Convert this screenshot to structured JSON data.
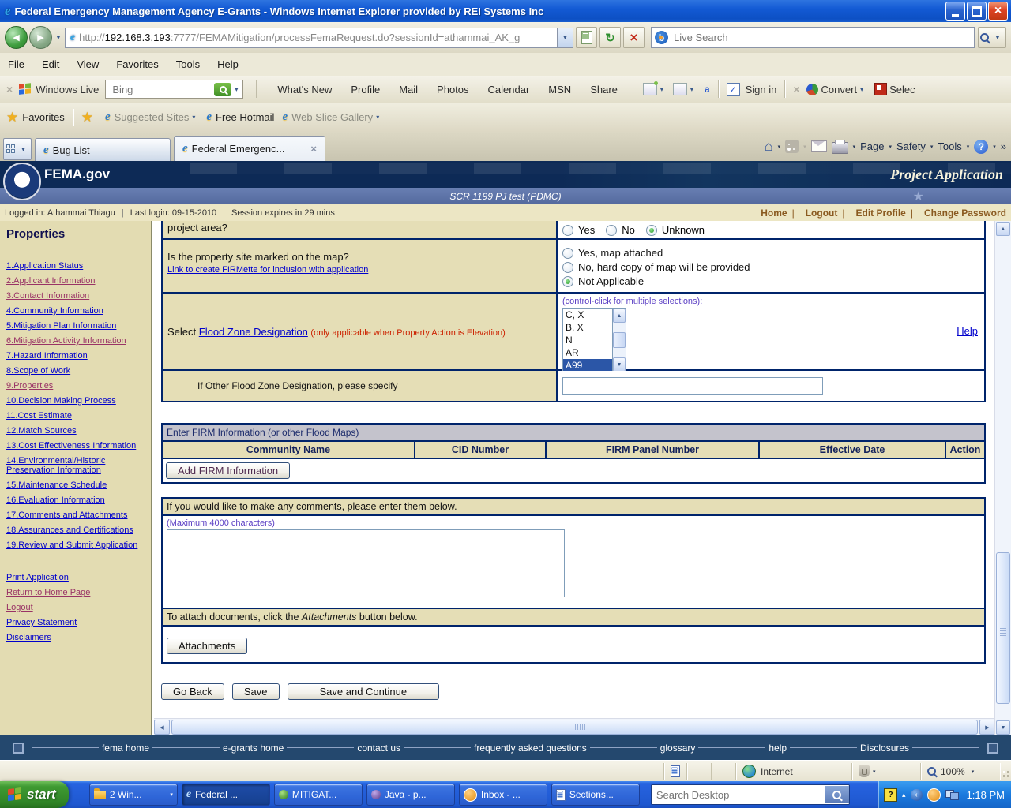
{
  "icons": {
    "dropdown": "▼",
    "dropdown_small": "▾",
    "overflow": "»",
    "close": "×",
    "back_arrow": "◀",
    "fwd_arrow": "▶",
    "scroll_up": "▲",
    "scroll_down": "▼",
    "scroll_left": "◀",
    "scroll_right": "▶",
    "refresh": "↻",
    "stop": "×",
    "check": "✓",
    "question": "?",
    "house": "⌂",
    "star": "★",
    "e_logo": "e",
    "bing_b": "b",
    "translate_a": "a",
    "tray_collapse": "‹",
    "tray_expand": "▴",
    "pipe": "|"
  },
  "window": {
    "title": "Federal Emergency Management Agency E-Grants - Windows Internet Explorer provided by REI Systems Inc",
    "url_prefix": "http://",
    "url_host": "192.168.3.193",
    "url_rest": ":7777/FEMAMitigation/processFemaRequest.do?sessionId=athammai_AK_g",
    "live_search_placeholder": "Live Search"
  },
  "menu": {
    "items": [
      "File",
      "Edit",
      "View",
      "Favorites",
      "Tools",
      "Help"
    ]
  },
  "live_bar": {
    "brand": "Windows Live",
    "search_placeholder": "Bing",
    "links": [
      "What's New",
      "Profile",
      "Mail",
      "Photos",
      "Calendar",
      "MSN",
      "Share"
    ],
    "sign_in": "Sign in",
    "convert": "Convert",
    "select": "Selec"
  },
  "favorites_bar": {
    "favorites": "Favorites",
    "suggested_sites": "Suggested Sites",
    "free_hotmail": "Free Hotmail",
    "web_slice": "Web Slice Gallery"
  },
  "tabs": {
    "tab1": "Bug List",
    "tab2": "Federal Emergenc..."
  },
  "command_bar": {
    "page": "Page",
    "safety": "Safety",
    "tools": "Tools"
  },
  "fema_header": {
    "brand": "FEMA.gov",
    "app_title": "Project Application",
    "subtitle": "SCR 1199 PJ test (PDMC)"
  },
  "session_bar": {
    "logged_in": "Logged in: Athammai Thiagu",
    "last_login": "Last login: 09-15-2010",
    "expires": "Session expires in 29 mins",
    "links": [
      "Home",
      "Logout",
      "Edit Profile",
      "Change Password"
    ]
  },
  "sidebar": {
    "title": "Properties",
    "items": [
      {
        "label": "1.Application Status"
      },
      {
        "label": "2.Applicant Information"
      },
      {
        "label": "3.Contact Information"
      },
      {
        "label": "4.Community Information"
      },
      {
        "label": "5.Mitigation Plan Information"
      },
      {
        "label": "6.Mitigation Activity Information"
      },
      {
        "label": "7.Hazard Information"
      },
      {
        "label": "8.Scope of Work"
      },
      {
        "label": "9.Properties"
      },
      {
        "label": "10.Decision Making Process"
      },
      {
        "label": "11.Cost Estimate"
      },
      {
        "label": "12.Match Sources"
      },
      {
        "label": "13.Cost Effectiveness Information"
      },
      {
        "label": "14.Environmental/Historic Preservation Information"
      },
      {
        "label": "15.Maintenance Schedule"
      },
      {
        "label": "16.Evaluation Information"
      },
      {
        "label": "17.Comments and Attachments"
      },
      {
        "label": "18.Assurances and Certifications"
      },
      {
        "label": "19.Review and Submit Application"
      }
    ],
    "extras": [
      {
        "label": "Print Application"
      },
      {
        "label": "Return to Home Page"
      },
      {
        "label": "Logout"
      },
      {
        "label": "Privacy Statement"
      },
      {
        "label": "Disclaimers"
      }
    ]
  },
  "form": {
    "q1_label": "project area?",
    "q1_options": [
      "Yes",
      "No",
      "Unknown"
    ],
    "q1_selected": "Unknown",
    "q2_question": "Is the property site marked on the map?",
    "q2_link": "Link to create FIRMette for inclusion with application",
    "q2_options": [
      "Yes, map attached",
      "No, hard copy of map will be provided",
      "Not Applicable"
    ],
    "q2_selected": "Not Applicable",
    "q3_prefix": "Select",
    "q3_link": "Flood Zone Designation",
    "q3_note": "(only applicable when Property Action is Elevation)",
    "q3_hint": "(control-click for multiple selections):",
    "q3_options": [
      "C, X",
      "B, X",
      "N",
      "AR",
      "A99"
    ],
    "q3_selected": "A99",
    "help_link": "Help",
    "q4_label": "If Other Flood Zone Designation, please specify",
    "q4_value": ""
  },
  "firm": {
    "header": "Enter FIRM Information (or other Flood Maps)",
    "columns": [
      "Community Name",
      "CID Number",
      "FIRM Panel Number",
      "Effective Date",
      "Action"
    ],
    "add_button": "Add FIRM Information"
  },
  "comments": {
    "header": "If you would like to make any comments, please enter them below.",
    "max_note": "(Maximum 4000 characters)",
    "value": "",
    "attach_pre": "To attach documents, click the ",
    "attach_word": "Attachments",
    "attach_post": " button below.",
    "attach_button": "Attachments"
  },
  "actions": {
    "go_back": "Go Back",
    "save": "Save",
    "save_continue": "Save and Continue"
  },
  "footer": {
    "links": [
      "fema home",
      "e-grants home",
      "contact us",
      "frequently asked questions",
      "glossary",
      "help",
      "Disclosures"
    ]
  },
  "status_bar": {
    "zone": "Internet",
    "zoom_level": "100%"
  },
  "taskbar": {
    "start": "start",
    "buttons": [
      "2 Win...",
      "Federal ...",
      "MITIGAT...",
      "Java - p...",
      "Inbox - ...",
      "Sections..."
    ],
    "search_placeholder": "Search Desktop",
    "time": "1:18 PM"
  },
  "colors": {
    "link_blue": "#0000cc",
    "link_visited": "#993366",
    "note_red": "#cc2200",
    "hint_purple": "#5b3fc4",
    "selection_blue": "#2b56a7",
    "table_border": "#00246b",
    "panel_tan": "#e5deb6",
    "footer_navy": "#24486e",
    "header_navy": "#0d2a56",
    "titlebar_blue": "#135ad4",
    "taskbar_blue": "#2663e0"
  }
}
